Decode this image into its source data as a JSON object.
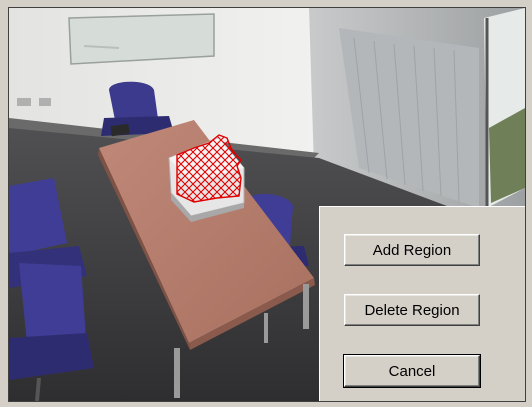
{
  "buttons": {
    "add_region": "Add Region",
    "delete_region": "Delete Region",
    "cancel": "Cancel"
  },
  "region": {
    "overlay_color": "#e00000",
    "pattern": "crosshatch"
  }
}
